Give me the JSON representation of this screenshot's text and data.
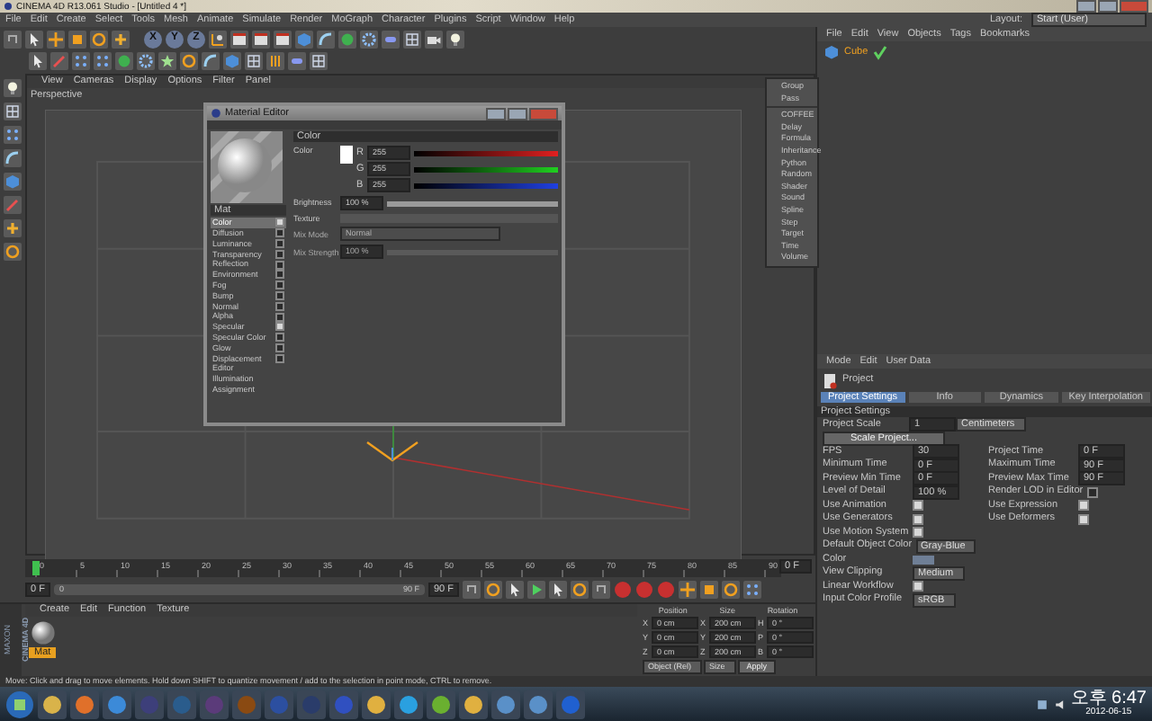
{
  "window": {
    "title": "CINEMA 4D R13.061 Studio - [Untitled 4 *]"
  },
  "menu_bar": [
    "File",
    "Edit",
    "Create",
    "Select",
    "Tools",
    "Mesh",
    "Animate",
    "Simulate",
    "Render",
    "MoGraph",
    "Character",
    "Plugins",
    "Script",
    "Window",
    "Help"
  ],
  "layout": {
    "label": "Layout:",
    "value": "Start (User)"
  },
  "axis_buttons": [
    "X",
    "Y",
    "Z"
  ],
  "viewport": {
    "menu": [
      "View",
      "Cameras",
      "Display",
      "Options",
      "Filter",
      "Panel"
    ],
    "camera": "Perspective"
  },
  "material_editor": {
    "title": "Material Editor",
    "name": "Mat",
    "channels": [
      {
        "label": "Color",
        "kind": "channel",
        "checked": true,
        "selected": true
      },
      {
        "label": "Diffusion",
        "kind": "channel",
        "checked": false,
        "selected": false
      },
      {
        "label": "Luminance",
        "kind": "channel",
        "checked": false,
        "selected": false
      },
      {
        "label": "Transparency",
        "kind": "channel",
        "checked": false,
        "selected": false
      },
      {
        "label": "Reflection",
        "kind": "channel",
        "checked": false,
        "selected": false
      },
      {
        "label": "Environment",
        "kind": "channel",
        "checked": false,
        "selected": false
      },
      {
        "label": "Fog",
        "kind": "channel",
        "checked": false,
        "selected": false
      },
      {
        "label": "Bump",
        "kind": "channel",
        "checked": false,
        "selected": false
      },
      {
        "label": "Normal",
        "kind": "channel",
        "checked": false,
        "selected": false
      },
      {
        "label": "Alpha",
        "kind": "channel",
        "checked": false,
        "selected": false
      },
      {
        "label": "Specular",
        "kind": "channel",
        "checked": true,
        "selected": false
      },
      {
        "label": "Specular Color",
        "kind": "channel",
        "checked": false,
        "selected": false
      },
      {
        "label": "Glow",
        "kind": "channel",
        "checked": false,
        "selected": false
      },
      {
        "label": "Displacement",
        "kind": "channel",
        "checked": false,
        "selected": false
      },
      {
        "label": "Editor",
        "kind": "page",
        "selected": false
      },
      {
        "label": "Illumination",
        "kind": "page",
        "selected": false
      },
      {
        "label": "Assignment",
        "kind": "page",
        "selected": false
      }
    ],
    "section": "Color",
    "color_label": "Color",
    "rgb": [
      {
        "channel": "R",
        "value": "255",
        "level": 1
      },
      {
        "channel": "G",
        "value": "255",
        "level": 1
      },
      {
        "channel": "B",
        "value": "255",
        "level": 1
      }
    ],
    "brightness": {
      "label": "Brightness",
      "value": "100 %",
      "level": 1
    },
    "texture": {
      "label": "Texture"
    },
    "mix_mode": {
      "label": "Mix Mode",
      "value": "Normal",
      "disabled": true
    },
    "mix_strength": {
      "label": "Mix Strength",
      "value": "100 %",
      "disabled": true
    }
  },
  "tag_menu": {
    "groups": [
      [
        "Group",
        "Pass"
      ],
      [
        "COFFEE",
        "Delay",
        "Formula",
        "Inheritance",
        "Python",
        "Random",
        "Shader",
        "Sound",
        "Spline",
        "Step",
        "Target",
        "Time",
        "Volume"
      ]
    ]
  },
  "objects": {
    "menu": [
      "File",
      "Edit",
      "View",
      "Objects",
      "Tags",
      "Bookmarks"
    ],
    "items": [
      {
        "name": "Cube"
      }
    ]
  },
  "attributes": {
    "menu": [
      "Mode",
      "Edit",
      "User Data"
    ],
    "title": "Project",
    "tabs": [
      {
        "label": "Project Settings",
        "selected": true
      },
      {
        "label": "Info",
        "selected": false
      },
      {
        "label": "Dynamics",
        "selected": false
      },
      {
        "label": "Key Interpolation",
        "selected": false
      }
    ],
    "section": "Project Settings",
    "scale": {
      "label": "Project Scale",
      "value": "1",
      "unit": "Centimeters"
    },
    "scale_button": "Scale Project...",
    "rows": [
      [
        {
          "label": "FPS",
          "kind": "number",
          "value": "30"
        },
        {
          "label": "Project Time",
          "kind": "number",
          "value": "0 F"
        }
      ],
      [
        {
          "label": "Minimum Time",
          "kind": "number",
          "value": "0 F"
        },
        {
          "label": "Maximum Time",
          "kind": "number",
          "value": "90 F"
        }
      ],
      [
        {
          "label": "Preview Min Time",
          "kind": "number",
          "value": "0 F"
        },
        {
          "label": "Preview Max Time",
          "kind": "number",
          "value": "90 F"
        }
      ],
      [
        {
          "label": "Level of Detail",
          "kind": "number",
          "value": "100 %"
        },
        {
          "label": "Render LOD in Editor",
          "kind": "check",
          "checked": false
        }
      ],
      [
        {
          "label": "Use Animation",
          "kind": "check",
          "checked": true
        },
        {
          "label": "Use Expression",
          "kind": "check",
          "checked": true
        }
      ],
      [
        {
          "label": "Use Generators",
          "kind": "check",
          "checked": true
        },
        {
          "label": "Use Deformers",
          "kind": "check",
          "checked": true
        }
      ],
      [
        {
          "label": "Use Motion System",
          "kind": "check",
          "checked": true
        }
      ],
      [
        {
          "label": "Default Object Color",
          "kind": "dropdown",
          "value": "Gray-Blue"
        }
      ],
      [
        {
          "label": "Color",
          "kind": "swatch"
        }
      ],
      [
        {
          "label": "View Clipping",
          "kind": "dropdown",
          "value": "Medium"
        }
      ],
      [
        {
          "label": "Linear Workflow",
          "kind": "check",
          "checked": true
        }
      ],
      [
        {
          "label": "Input Color Profile",
          "kind": "dropdown",
          "value": "sRGB"
        }
      ]
    ]
  },
  "timeline": {
    "ticks": [
      "0",
      "5",
      "10",
      "15",
      "20",
      "25",
      "30",
      "35",
      "40",
      "45",
      "50",
      "55",
      "60",
      "65",
      "70",
      "75",
      "80",
      "85",
      "90"
    ],
    "current": "0 F",
    "min_field": "0 F",
    "range": {
      "start": "0",
      "end": "90 F",
      "level": 1
    },
    "max_field": "90 F"
  },
  "material_manager": {
    "menu": [
      "Create",
      "Edit",
      "Function",
      "Texture"
    ],
    "materials": [
      {
        "name": "Mat",
        "selected": true
      }
    ]
  },
  "logo": [
    "MAXON",
    "CINEMA 4D"
  ],
  "coordinates": {
    "headers": [
      "Position",
      "Size",
      "Rotation"
    ],
    "rows": [
      [
        {
          "axis": "X",
          "value": "0 cm"
        },
        {
          "axis": "X",
          "value": "200 cm"
        },
        {
          "axis": "H",
          "value": "0 °"
        }
      ],
      [
        {
          "axis": "Y",
          "value": "0 cm"
        },
        {
          "axis": "Y",
          "value": "200 cm"
        },
        {
          "axis": "P",
          "value": "0 °"
        }
      ],
      [
        {
          "axis": "Z",
          "value": "0 cm"
        },
        {
          "axis": "Z",
          "value": "200 cm"
        },
        {
          "axis": "B",
          "value": "0 °"
        }
      ]
    ],
    "mode": "Object (Rel)",
    "size_mode": "Size",
    "apply": "Apply"
  },
  "status_bar": "Move: Click and drag to move elements. Hold down SHIFT to quantize movement / add to the selection in point mode, CTRL to remove.",
  "taskbar": {
    "time": "오후 6:47",
    "date": "2012-06-15"
  }
}
